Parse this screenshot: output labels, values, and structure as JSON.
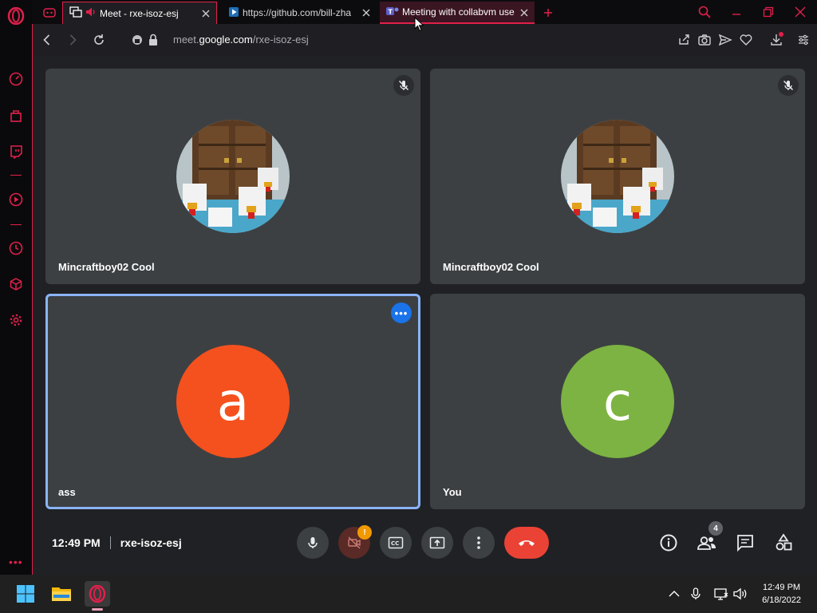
{
  "browser": {
    "tabs": [
      {
        "title": "Meet - rxe-isoz-esj",
        "state": "active"
      },
      {
        "title": "https://github.com/bill-zha",
        "state": "normal"
      },
      {
        "title": "Meeting with collabvm use",
        "state": "highlight"
      }
    ],
    "url_prefix": "meet.",
    "url_domain": "google.com",
    "url_path": "/rxe-isoz-esj",
    "accent_color": "#e0204b"
  },
  "meet": {
    "tiles": [
      {
        "name": "Mincraftboy02 Cool",
        "type": "photo",
        "muted": true
      },
      {
        "name": "Mincraftboy02 Cool",
        "type": "photo",
        "muted": true
      },
      {
        "name": "ass",
        "type": "letter",
        "letter": "a",
        "color": "#f4511e",
        "speaking": true
      },
      {
        "name": "You",
        "type": "letter",
        "letter": "c",
        "color": "#7cb342"
      }
    ],
    "time": "12:49 PM",
    "meeting_code": "rxe-isoz-esj",
    "participants_count": "4",
    "camera_alert": "!",
    "end_call_color": "#ea4335"
  },
  "taskbar": {
    "time": "12:49 PM",
    "date": "6/18/2022"
  }
}
